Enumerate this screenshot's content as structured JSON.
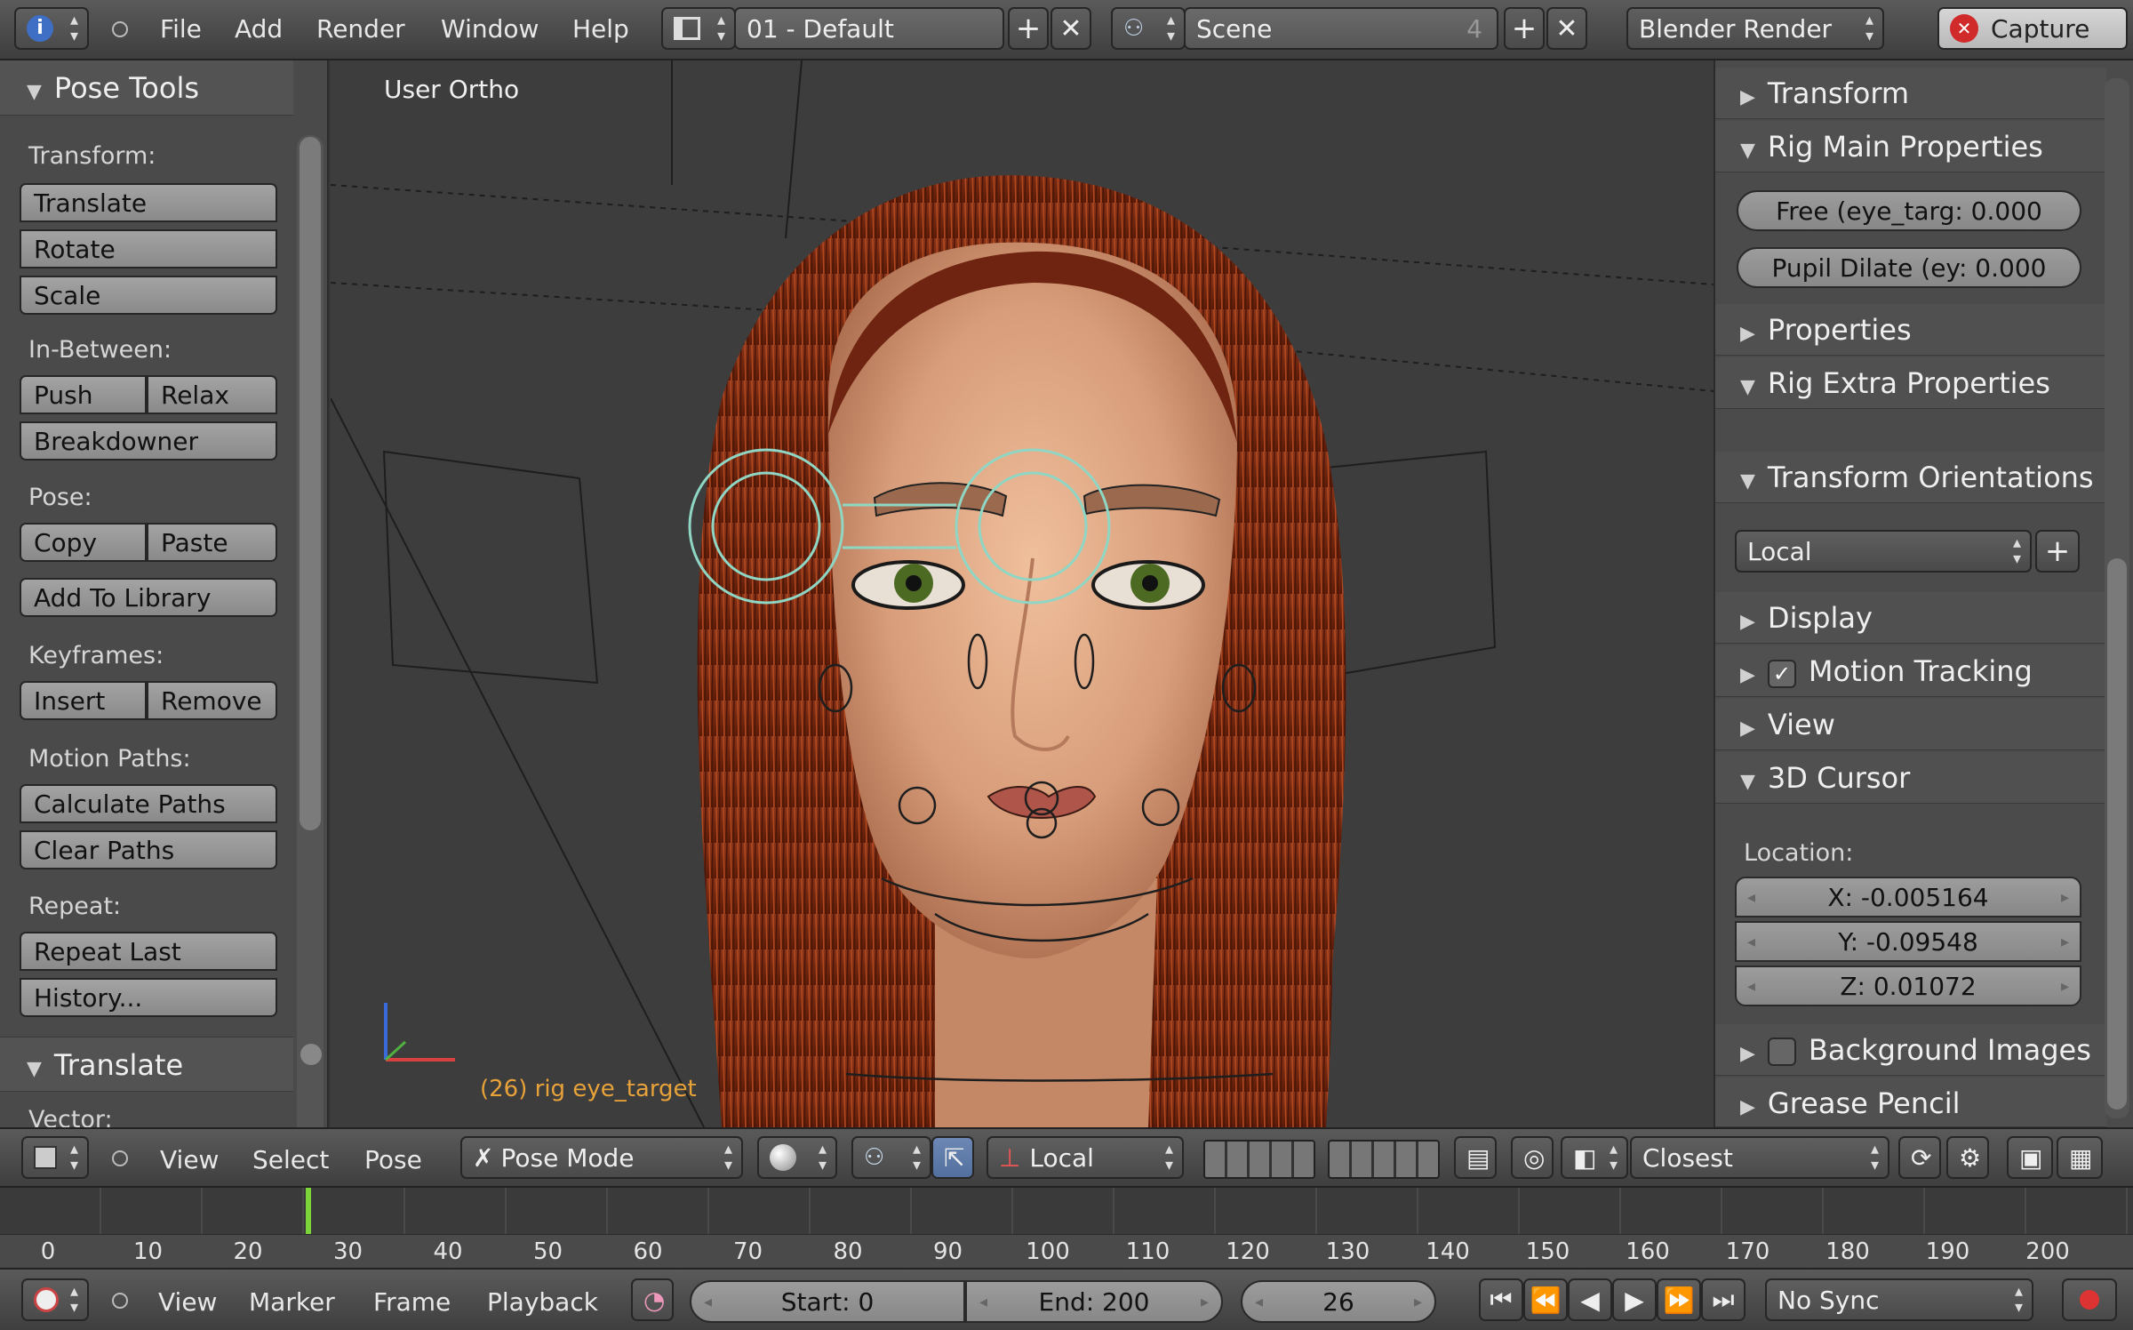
{
  "top_bar": {
    "menus": [
      "File",
      "Add",
      "Render",
      "Window",
      "Help"
    ],
    "screen_layout": "01 - Default",
    "scene": "Scene",
    "scene_users": "4",
    "render_engine": "Blender Render",
    "capture_label": "Capture"
  },
  "tool_shelf": {
    "title": "Pose Tools",
    "transform_label": "Transform:",
    "translate": "Translate",
    "rotate": "Rotate",
    "scale": "Scale",
    "inbetween_label": "In-Between:",
    "push": "Push",
    "relax": "Relax",
    "breakdowner": "Breakdowner",
    "pose_label": "Pose:",
    "copy": "Copy",
    "paste": "Paste",
    "add_to_library": "Add To Library",
    "keyframes_label": "Keyframes:",
    "insert": "Insert",
    "remove": "Remove",
    "motion_paths_label": "Motion Paths:",
    "calculate_paths": "Calculate Paths",
    "clear_paths": "Clear Paths",
    "repeat_label": "Repeat:",
    "repeat_last": "Repeat Last",
    "history": "History...",
    "operator_title": "Translate",
    "vector_label": "Vector:"
  },
  "viewport": {
    "view_name": "User Ortho",
    "active_object": "(26) rig eye_target"
  },
  "properties": {
    "transform": "Transform",
    "rig_main": "Rig Main Properties",
    "free_eye": "Free (eye_targ: 0.000",
    "pupil_dilate": "Pupil Dilate (ey: 0.000",
    "properties": "Properties",
    "rig_extra": "Rig Extra Properties",
    "transform_orientations": "Transform Orientations",
    "orientation_value": "Local",
    "display": "Display",
    "motion_tracking": "Motion Tracking",
    "view": "View",
    "cursor_3d": "3D Cursor",
    "location_label": "Location:",
    "loc_x": "X: -0.005164",
    "loc_y": "Y: -0.09548",
    "loc_z": "Z: 0.01072",
    "background_images": "Background Images",
    "grease_pencil": "Grease Pencil"
  },
  "view_header": {
    "menus": [
      "View",
      "Select",
      "Pose"
    ],
    "mode": "Pose Mode",
    "orientation": "Local",
    "snap": "Closest"
  },
  "timeline": {
    "ticks": [
      "0",
      "10",
      "20",
      "30",
      "40",
      "50",
      "60",
      "70",
      "80",
      "90",
      "100",
      "110",
      "120",
      "130",
      "140",
      "150",
      "160",
      "170",
      "180",
      "190",
      "200"
    ],
    "current_frame_value": 26,
    "menus": [
      "View",
      "Marker",
      "Frame",
      "Playback"
    ],
    "start": "Start: 0",
    "end": "End: 200",
    "current": "26",
    "sync": "No Sync"
  },
  "colors": {
    "hair": "#7a2a12",
    "skin": "#d9a080",
    "eye_control": "#8fd6c4",
    "frame_indicator": "#7cd63a",
    "active_text": "#e8a23a"
  }
}
